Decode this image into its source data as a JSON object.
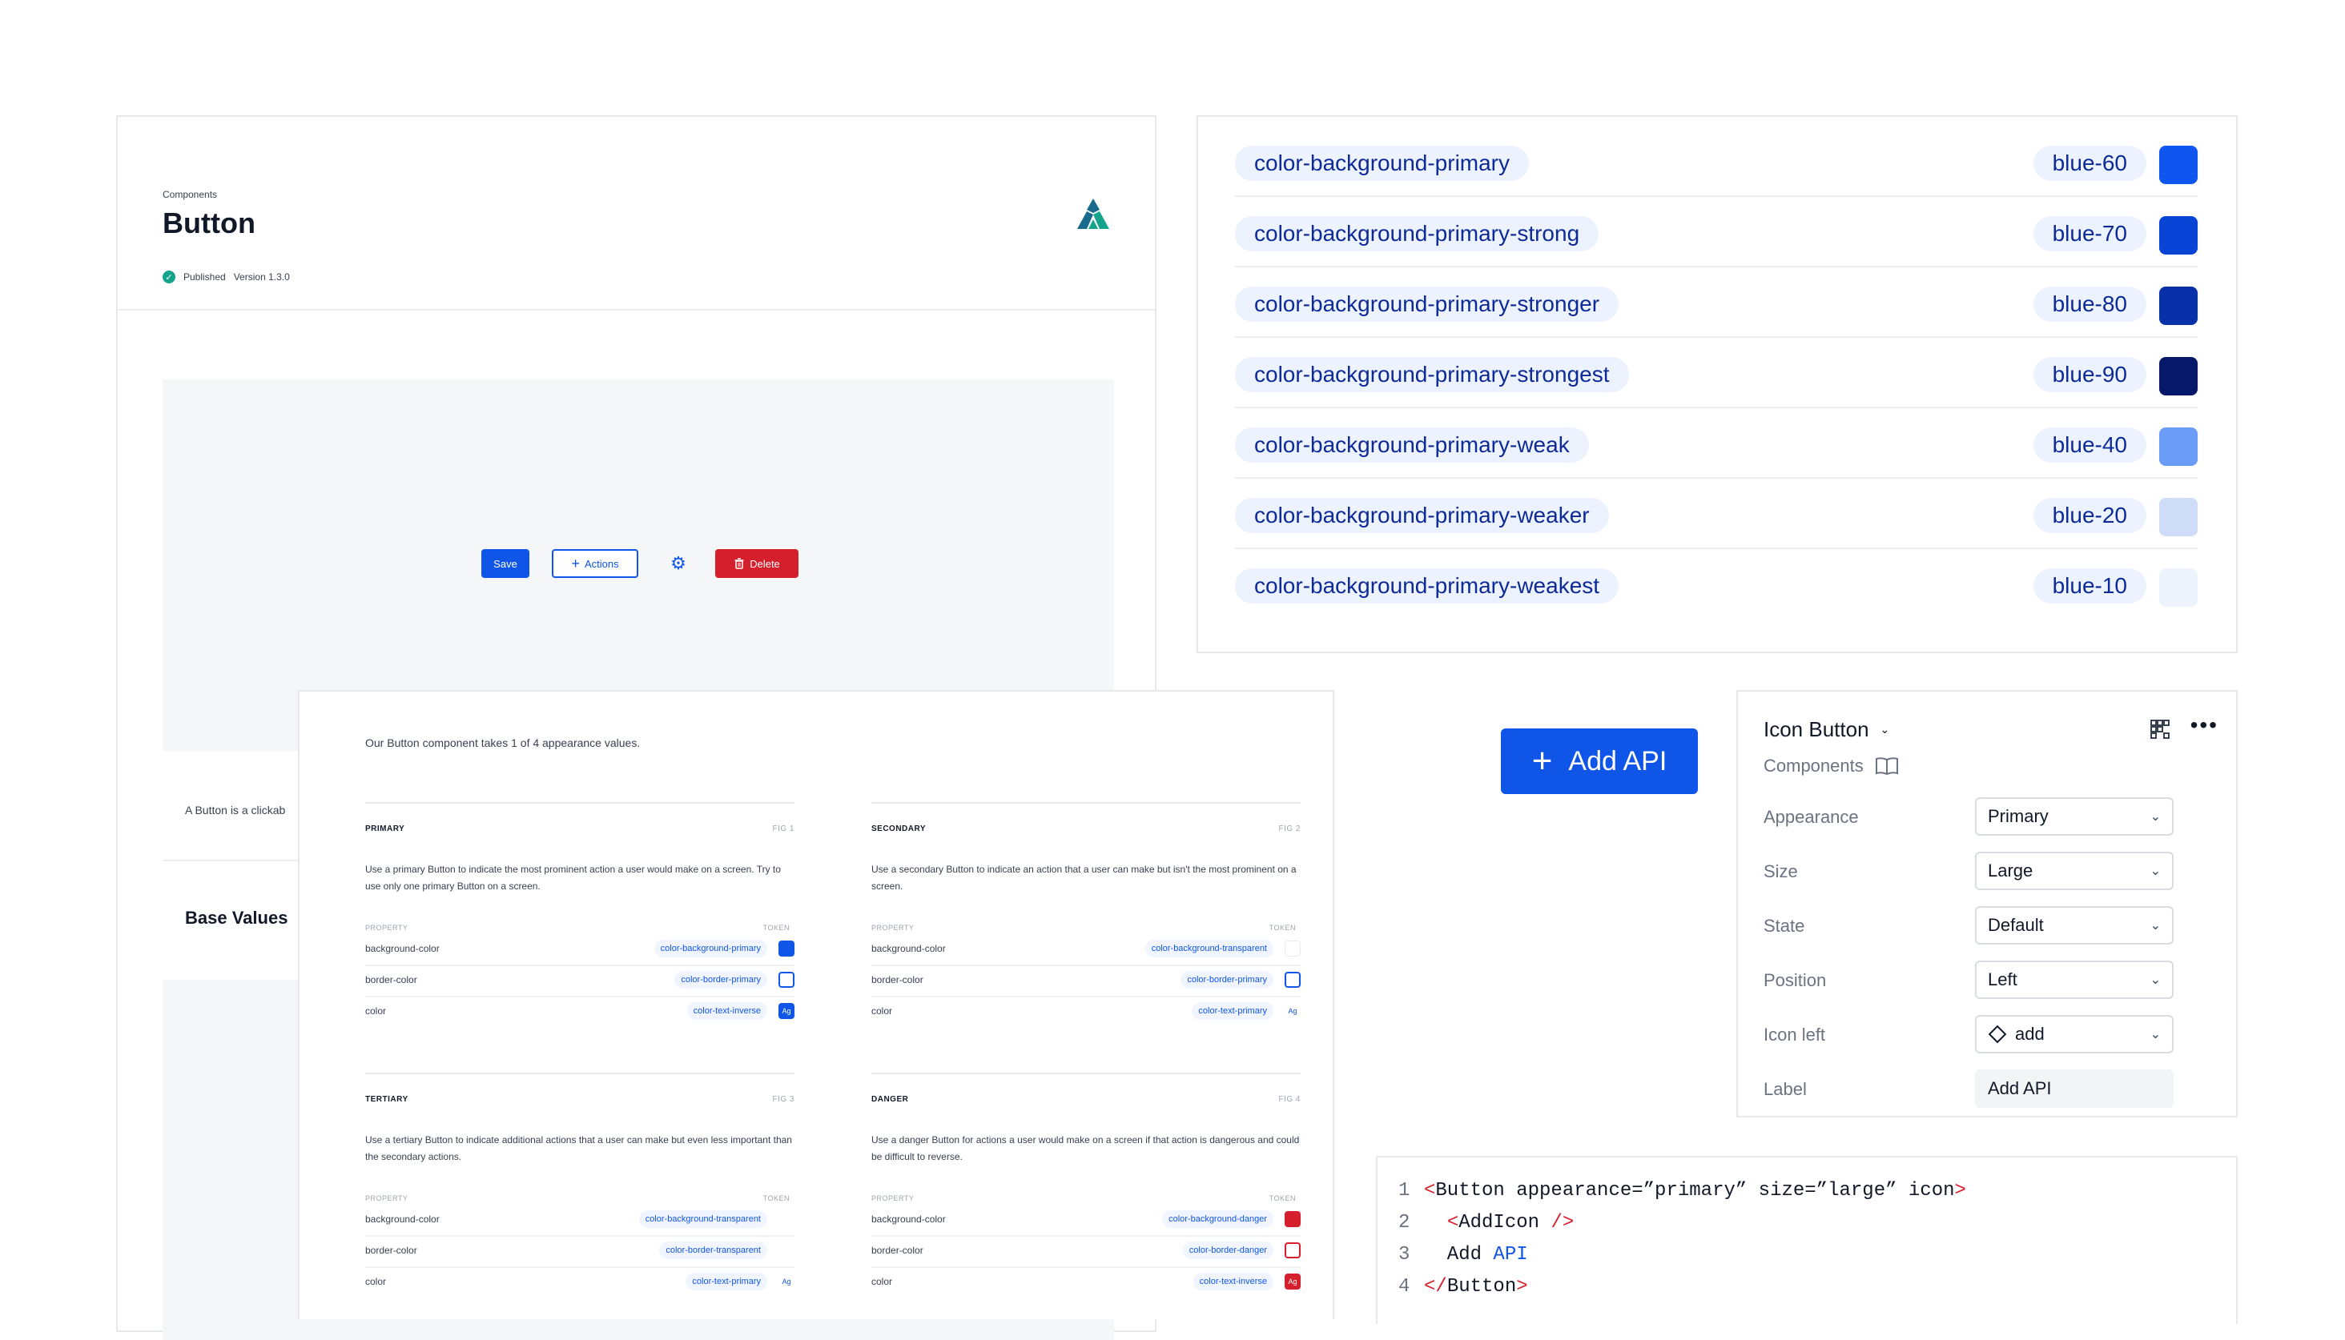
{
  "doc": {
    "breadcrumb": "Components",
    "title": "Button",
    "status": "Published",
    "version": "Version 1.3.0",
    "preview_buttons": {
      "save": "Save",
      "actions": "Actions",
      "delete": "Delete"
    },
    "intro_text": "A Button is a clickab",
    "section_heading": "Base Values"
  },
  "tokens": [
    {
      "name": "color-background-primary",
      "value": "blue-60",
      "color": "#0f55f0"
    },
    {
      "name": "color-background-primary-strong",
      "value": "blue-70",
      "color": "#0a44d6"
    },
    {
      "name": "color-background-primary-stronger",
      "value": "blue-80",
      "color": "#0830a8"
    },
    {
      "name": "color-background-primary-strongest",
      "value": "blue-90",
      "color": "#06186a"
    },
    {
      "name": "color-background-primary-weak",
      "value": "blue-40",
      "color": "#6b9cf7"
    },
    {
      "name": "color-background-primary-weaker",
      "value": "blue-20",
      "color": "#cfddf8"
    },
    {
      "name": "color-background-primary-weakest",
      "value": "blue-10",
      "color": "#eef4fd"
    }
  ],
  "appearance": {
    "intro": "Our Button component takes 1 of 4 appearance values.",
    "property_header": "PROPERTY",
    "token_header": "TOKEN",
    "sections": [
      {
        "title": "PRIMARY",
        "fig": "FIG 1",
        "desc": "Use a primary Button to indicate the most prominent action a user would make on a screen. Try to use only one primary Button on a screen.",
        "rows": [
          {
            "prop": "background-color",
            "token": "color-background-primary",
            "swatch": "fill-blue"
          },
          {
            "prop": "border-color",
            "token": "color-border-primary",
            "swatch": "outline-blue"
          },
          {
            "prop": "color",
            "token": "color-text-inverse",
            "swatch": "ag-inverse-blue"
          }
        ]
      },
      {
        "title": "SECONDARY",
        "fig": "FIG 2",
        "desc": "Use a secondary Button to indicate an action that a user can make but isn't the most prominent on a screen.",
        "rows": [
          {
            "prop": "background-color",
            "token": "color-background-transparent",
            "swatch": "transparent"
          },
          {
            "prop": "border-color",
            "token": "color-border-primary",
            "swatch": "outline-blue"
          },
          {
            "prop": "color",
            "token": "color-text-primary",
            "swatch": "ag-blue"
          }
        ]
      },
      {
        "title": "TERTIARY",
        "fig": "FIG 3",
        "desc": "Use a tertiary Button to indicate additional actions that a user can make but even less important than the secondary actions.",
        "rows": [
          {
            "prop": "background-color",
            "token": "color-background-transparent",
            "swatch": "none"
          },
          {
            "prop": "border-color",
            "token": "color-border-transparent",
            "swatch": "none"
          },
          {
            "prop": "color",
            "token": "color-text-primary",
            "swatch": "ag-blue"
          }
        ]
      },
      {
        "title": "DANGER",
        "fig": "FIG 4",
        "desc": "Use a danger Button for actions a user would make on a screen if that action is dangerous and could be difficult to reverse.",
        "rows": [
          {
            "prop": "background-color",
            "token": "color-background-danger",
            "swatch": "fill-red"
          },
          {
            "prop": "border-color",
            "token": "color-border-danger",
            "swatch": "outline-red"
          },
          {
            "prop": "color",
            "token": "color-text-inverse",
            "swatch": "ag-inverse-red"
          }
        ]
      }
    ],
    "swatch_text": "Ag"
  },
  "add_api_button": {
    "label": "Add API"
  },
  "props_panel": {
    "title": "Icon Button",
    "subtitle": "Components",
    "rows": [
      {
        "label": "Appearance",
        "value": "Primary",
        "kind": "select"
      },
      {
        "label": "Size",
        "value": "Large",
        "kind": "select"
      },
      {
        "label": "State",
        "value": "Default",
        "kind": "select"
      },
      {
        "label": "Position",
        "value": "Left",
        "kind": "select"
      },
      {
        "label": "Icon left",
        "value": "add",
        "kind": "select-icon"
      },
      {
        "label": "Label",
        "value": "Add API",
        "kind": "input"
      }
    ]
  },
  "code": {
    "lines": [
      {
        "num": "1",
        "parts": [
          [
            "tag",
            "<"
          ],
          [
            "attr",
            "Button appearance=”primary” size=”large” icon"
          ],
          [
            "tag",
            ">"
          ]
        ]
      },
      {
        "num": "2",
        "parts": [
          [
            "plain",
            "  "
          ],
          [
            "tag",
            "<"
          ],
          [
            "attr",
            "AddIcon "
          ],
          [
            "tag",
            "/>"
          ]
        ]
      },
      {
        "num": "3",
        "parts": [
          [
            "plain",
            "  Add "
          ],
          [
            "kw",
            "API"
          ]
        ]
      },
      {
        "num": "4",
        "parts": [
          [
            "tag",
            "</"
          ],
          [
            "attr",
            "Button"
          ],
          [
            "tag",
            ">"
          ]
        ]
      }
    ]
  },
  "colors": {
    "primary": "#0f55e8",
    "danger": "#d61f2c",
    "token_text": "#0d2a96",
    "published": "#14a38b"
  }
}
